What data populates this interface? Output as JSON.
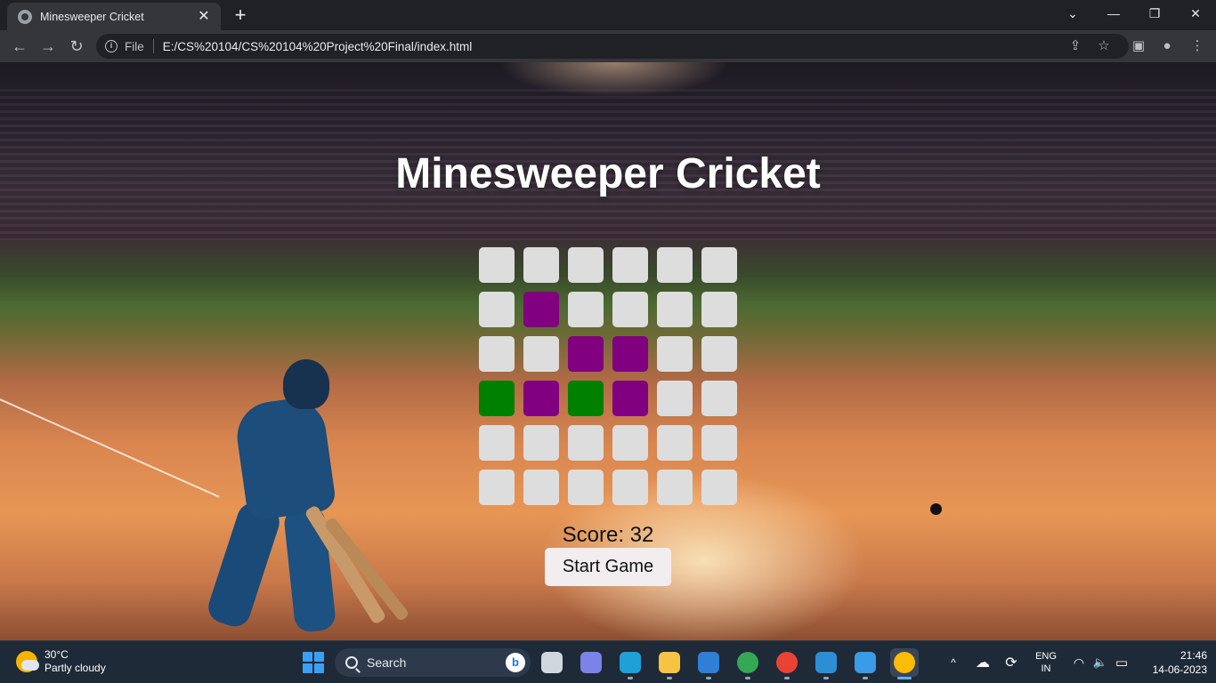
{
  "browser": {
    "tab_title": "Minesweeper Cricket",
    "tab_close": "✕",
    "new_tab": "+",
    "window_controls": {
      "dropdown": "⌄",
      "minimize": "—",
      "restore": "❐",
      "close": "✕"
    },
    "nav": {
      "back": "←",
      "forward": "→",
      "reload": "↻"
    },
    "omnibox": {
      "scheme_label": "File",
      "url": "E:/CS%20104/CS%20104%20Project%20Final/index.html"
    },
    "toolbar_icons": {
      "share": "⇪",
      "bookmark": "☆",
      "side_panel": "▣",
      "profile": "●",
      "menu": "⋮"
    }
  },
  "page": {
    "title": "Minesweeper Cricket",
    "grid": {
      "rows": 6,
      "cols": 6,
      "cells": [
        [
          "unrevealed",
          "unrevealed",
          "unrevealed",
          "unrevealed",
          "unrevealed",
          "unrevealed"
        ],
        [
          "unrevealed",
          "clicked",
          "unrevealed",
          "unrevealed",
          "unrevealed",
          "unrevealed"
        ],
        [
          "unrevealed",
          "unrevealed",
          "clicked",
          "clicked",
          "unrevealed",
          "unrevealed"
        ],
        [
          "safe",
          "clicked",
          "safe",
          "clicked",
          "unrevealed",
          "unrevealed"
        ],
        [
          "unrevealed",
          "unrevealed",
          "unrevealed",
          "unrevealed",
          "unrevealed",
          "unrevealed"
        ],
        [
          "unrevealed",
          "unrevealed",
          "unrevealed",
          "unrevealed",
          "unrevealed",
          "unrevealed"
        ]
      ],
      "colors": {
        "unrevealed": "#dddddd",
        "clicked": "#800080",
        "safe": "#008000"
      }
    },
    "score_text": "Score: 32",
    "start_button": "Start Game"
  },
  "taskbar": {
    "weather": {
      "temp": "30°C",
      "condition": "Partly cloudy"
    },
    "search_label": "Search",
    "bing_label": "b",
    "apps": [
      {
        "name": "task-view",
        "color": "#cfd6de"
      },
      {
        "name": "teams-chat",
        "color": "#7b83eb"
      },
      {
        "name": "edge",
        "color": "#1fa0d6"
      },
      {
        "name": "file-explorer",
        "color": "#f6c343"
      },
      {
        "name": "microsoft-store",
        "color": "#2f7fd6"
      },
      {
        "name": "chrome-profile-s",
        "color": "#34a853"
      },
      {
        "name": "chrome-profile-2",
        "color": "#ea4335"
      },
      {
        "name": "vscode",
        "color": "#2c8fd6"
      },
      {
        "name": "photos",
        "color": "#3a9be8"
      },
      {
        "name": "chrome-active",
        "color": "#fbbc05"
      }
    ],
    "tray": {
      "chevron": "^",
      "cloud": "☁",
      "sync": "⟳",
      "lang_top": "ENG",
      "lang_bottom": "IN",
      "wifi": "◠",
      "volume": "🔈",
      "battery": "▭"
    },
    "clock": {
      "time": "21:46",
      "date": "14-06-2023"
    }
  }
}
